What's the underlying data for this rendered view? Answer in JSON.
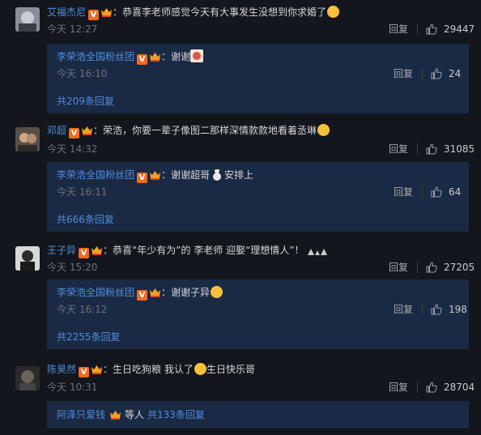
{
  "comments": [
    {
      "name": "艾福杰尼",
      "text": "：恭喜李老师感觉今天有大事发生没想到你求婚了",
      "time": "今天 12:27",
      "reply_label": "回复",
      "likes": "29447",
      "reply": {
        "name": "李荣浩全国粉丝团",
        "text": "：谢谢",
        "time": "今天 16:10",
        "reply_label": "回复",
        "likes": "24"
      },
      "more": "共209条回复"
    },
    {
      "name": "邓超",
      "text": "：荣浩，你要一辈子像图二那样深情款款地看着丞琳",
      "time": "今天 14:32",
      "reply_label": "回复",
      "likes": "31085",
      "reply": {
        "name": "李荣浩全国粉丝团",
        "text": "：谢谢超哥",
        "text2": "安排上",
        "time": "今天 16:11",
        "reply_label": "回复",
        "likes": "64"
      },
      "more": "共666条回复"
    },
    {
      "name": "王子异",
      "text": "：恭喜“年少有为”的 李老师 迎娶“理想情人”！",
      "time": "今天 15:20",
      "reply_label": "回复",
      "likes": "27205",
      "reply": {
        "name": "李荣浩全国粉丝团",
        "text": "：谢谢子异",
        "time": "今天 16:12",
        "reply_label": "回复",
        "likes": "198"
      },
      "more": "共2255条回复"
    },
    {
      "name": "陈昊然",
      "text": "：生日吃狗粮 我认了",
      "text2": "生日快乐哥",
      "time": "今天 10:31",
      "reply_label": "回复",
      "likes": "28704",
      "reply_preview": {
        "name": "阿泽只爱钱",
        "text": "等人",
        "more": "共133条回复"
      }
    }
  ],
  "colors": {
    "background": "#13161d",
    "reply_box": "#1b2a44",
    "link": "#4e8edf",
    "badge": "#f06b1e"
  }
}
